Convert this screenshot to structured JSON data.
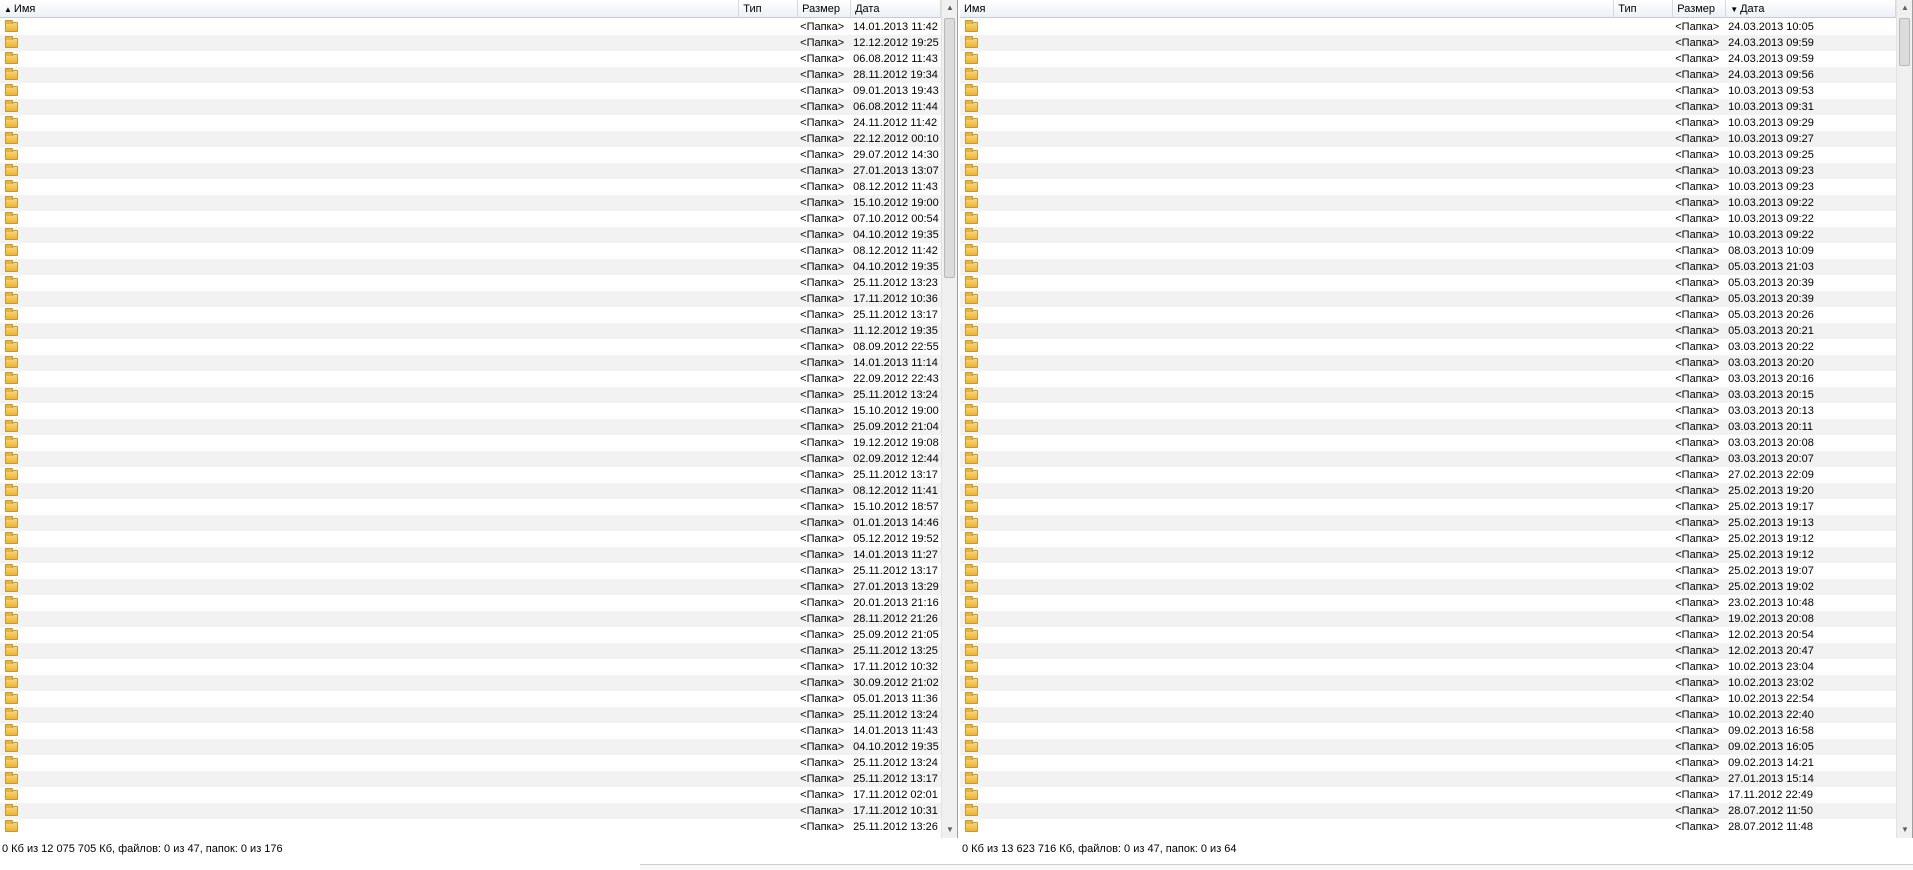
{
  "columns": {
    "name": "Имя",
    "type": "Тип",
    "size": "Размер",
    "date": "Дата"
  },
  "left": {
    "sorted_by": "name",
    "rows": [
      {
        "size": "<Папка>",
        "date": "14.01.2013 11:42"
      },
      {
        "size": "<Папка>",
        "date": "12.12.2012 19:25"
      },
      {
        "size": "<Папка>",
        "date": "06.08.2012 11:43"
      },
      {
        "size": "<Папка>",
        "date": "28.11.2012 19:34"
      },
      {
        "size": "<Папка>",
        "date": "09.01.2013 19:43"
      },
      {
        "size": "<Папка>",
        "date": "06.08.2012 11:44"
      },
      {
        "size": "<Папка>",
        "date": "24.11.2012 11:42"
      },
      {
        "size": "<Папка>",
        "date": "22.12.2012 00:10"
      },
      {
        "size": "<Папка>",
        "date": "29.07.2012 14:30"
      },
      {
        "size": "<Папка>",
        "date": "27.01.2013 13:07"
      },
      {
        "size": "<Папка>",
        "date": "08.12.2012 11:43"
      },
      {
        "size": "<Папка>",
        "date": "15.10.2012 19:00"
      },
      {
        "size": "<Папка>",
        "date": "07.10.2012 00:54"
      },
      {
        "size": "<Папка>",
        "date": "04.10.2012 19:35"
      },
      {
        "size": "<Папка>",
        "date": "08.12.2012 11:42"
      },
      {
        "size": "<Папка>",
        "date": "04.10.2012 19:35"
      },
      {
        "size": "<Папка>",
        "date": "25.11.2012 13:23"
      },
      {
        "size": "<Папка>",
        "date": "17.11.2012 10:36"
      },
      {
        "size": "<Папка>",
        "date": "25.11.2012 13:17"
      },
      {
        "size": "<Папка>",
        "date": "11.12.2012 19:35"
      },
      {
        "size": "<Папка>",
        "date": "08.09.2012 22:55"
      },
      {
        "size": "<Папка>",
        "date": "14.01.2013 11:14"
      },
      {
        "size": "<Папка>",
        "date": "22.09.2012 22:43"
      },
      {
        "size": "<Папка>",
        "date": "25.11.2012 13:24"
      },
      {
        "size": "<Папка>",
        "date": "15.10.2012 19:00"
      },
      {
        "size": "<Папка>",
        "date": "25.09.2012 21:04"
      },
      {
        "size": "<Папка>",
        "date": "19.12.2012 19:08"
      },
      {
        "size": "<Папка>",
        "date": "02.09.2012 12:44"
      },
      {
        "size": "<Папка>",
        "date": "25.11.2012 13:17"
      },
      {
        "size": "<Папка>",
        "date": "08.12.2012 11:41"
      },
      {
        "size": "<Папка>",
        "date": "15.10.2012 18:57"
      },
      {
        "size": "<Папка>",
        "date": "01.01.2013 14:46"
      },
      {
        "size": "<Папка>",
        "date": "05.12.2012 19:52"
      },
      {
        "size": "<Папка>",
        "date": "14.01.2013 11:27"
      },
      {
        "size": "<Папка>",
        "date": "25.11.2012 13:17"
      },
      {
        "size": "<Папка>",
        "date": "27.01.2013 13:29"
      },
      {
        "size": "<Папка>",
        "date": "20.01.2013 21:16"
      },
      {
        "size": "<Папка>",
        "date": "28.11.2012 21:26"
      },
      {
        "size": "<Папка>",
        "date": "25.09.2012 21:05"
      },
      {
        "size": "<Папка>",
        "date": "25.11.2012 13:25"
      },
      {
        "size": "<Папка>",
        "date": "17.11.2012 10:32"
      },
      {
        "size": "<Папка>",
        "date": "30.09.2012 21:02"
      },
      {
        "size": "<Папка>",
        "date": "05.01.2013 11:36"
      },
      {
        "size": "<Папка>",
        "date": "25.11.2012 13:24"
      },
      {
        "size": "<Папка>",
        "date": "14.01.2013 11:43"
      },
      {
        "size": "<Папка>",
        "date": "04.10.2012 19:35"
      },
      {
        "size": "<Папка>",
        "date": "25.11.2012 13:24"
      },
      {
        "size": "<Папка>",
        "date": "25.11.2012 13:17"
      },
      {
        "size": "<Папка>",
        "date": "17.11.2012 02:01"
      },
      {
        "size": "<Папка>",
        "date": "17.11.2012 10:31"
      },
      {
        "size": "<Папка>",
        "date": "25.11.2012 13:26"
      }
    ]
  },
  "right": {
    "sorted_by": "date",
    "rows": [
      {
        "size": "<Папка>",
        "date": "24.03.2013 10:05"
      },
      {
        "size": "<Папка>",
        "date": "24.03.2013 09:59"
      },
      {
        "size": "<Папка>",
        "date": "24.03.2013 09:59"
      },
      {
        "size": "<Папка>",
        "date": "24.03.2013 09:56"
      },
      {
        "size": "<Папка>",
        "date": "10.03.2013 09:53"
      },
      {
        "size": "<Папка>",
        "date": "10.03.2013 09:31"
      },
      {
        "size": "<Папка>",
        "date": "10.03.2013 09:29"
      },
      {
        "size": "<Папка>",
        "date": "10.03.2013 09:27"
      },
      {
        "size": "<Папка>",
        "date": "10.03.2013 09:25"
      },
      {
        "size": "<Папка>",
        "date": "10.03.2013 09:23"
      },
      {
        "size": "<Папка>",
        "date": "10.03.2013 09:23"
      },
      {
        "size": "<Папка>",
        "date": "10.03.2013 09:22"
      },
      {
        "size": "<Папка>",
        "date": "10.03.2013 09:22"
      },
      {
        "size": "<Папка>",
        "date": "10.03.2013 09:22"
      },
      {
        "size": "<Папка>",
        "date": "08.03.2013 10:09"
      },
      {
        "size": "<Папка>",
        "date": "05.03.2013 21:03"
      },
      {
        "size": "<Папка>",
        "date": "05.03.2013 20:39"
      },
      {
        "size": "<Папка>",
        "date": "05.03.2013 20:39"
      },
      {
        "size": "<Папка>",
        "date": "05.03.2013 20:26"
      },
      {
        "size": "<Папка>",
        "date": "05.03.2013 20:21"
      },
      {
        "size": "<Папка>",
        "date": "03.03.2013 20:22"
      },
      {
        "size": "<Папка>",
        "date": "03.03.2013 20:20"
      },
      {
        "size": "<Папка>",
        "date": "03.03.2013 20:16"
      },
      {
        "size": "<Папка>",
        "date": "03.03.2013 20:15"
      },
      {
        "size": "<Папка>",
        "date": "03.03.2013 20:13"
      },
      {
        "size": "<Папка>",
        "date": "03.03.2013 20:11"
      },
      {
        "size": "<Папка>",
        "date": "03.03.2013 20:08"
      },
      {
        "size": "<Папка>",
        "date": "03.03.2013 20:07"
      },
      {
        "size": "<Папка>",
        "date": "27.02.2013 22:09"
      },
      {
        "size": "<Папка>",
        "date": "25.02.2013 19:20"
      },
      {
        "size": "<Папка>",
        "date": "25.02.2013 19:17"
      },
      {
        "size": "<Папка>",
        "date": "25.02.2013 19:13"
      },
      {
        "size": "<Папка>",
        "date": "25.02.2013 19:12"
      },
      {
        "size": "<Папка>",
        "date": "25.02.2013 19:12"
      },
      {
        "size": "<Папка>",
        "date": "25.02.2013 19:07"
      },
      {
        "size": "<Папка>",
        "date": "25.02.2013 19:02"
      },
      {
        "size": "<Папка>",
        "date": "23.02.2013 10:48"
      },
      {
        "size": "<Папка>",
        "date": "19.02.2013 20:08"
      },
      {
        "size": "<Папка>",
        "date": "12.02.2013 20:54"
      },
      {
        "size": "<Папка>",
        "date": "12.02.2013 20:47"
      },
      {
        "size": "<Папка>",
        "date": "10.02.2013 23:04"
      },
      {
        "size": "<Папка>",
        "date": "10.02.2013 23:02"
      },
      {
        "size": "<Папка>",
        "date": "10.02.2013 22:54"
      },
      {
        "size": "<Папка>",
        "date": "10.02.2013 22:40"
      },
      {
        "size": "<Папка>",
        "date": "09.02.2013 16:58"
      },
      {
        "size": "<Папка>",
        "date": "09.02.2013 16:05"
      },
      {
        "size": "<Папка>",
        "date": "09.02.2013 14:21"
      },
      {
        "size": "<Папка>",
        "date": "27.01.2013 15:14"
      },
      {
        "size": "<Папка>",
        "date": "17.11.2012 22:49"
      },
      {
        "size": "<Папка>",
        "date": "28.07.2012 11:50"
      },
      {
        "size": "<Папка>",
        "date": "28.07.2012 11:48"
      }
    ]
  },
  "status": {
    "left": "0 Кб из 12 075 705 Кб, файлов: 0 из 47, папок: 0 из 176",
    "right": "0 Кб из 13 623 716 Кб, файлов: 0 из 47, папок: 0 из 64"
  },
  "icons": {
    "folder": "folder-icon",
    "sort_up": "sort-ascending-icon",
    "sort_down": "sort-descending-icon"
  }
}
